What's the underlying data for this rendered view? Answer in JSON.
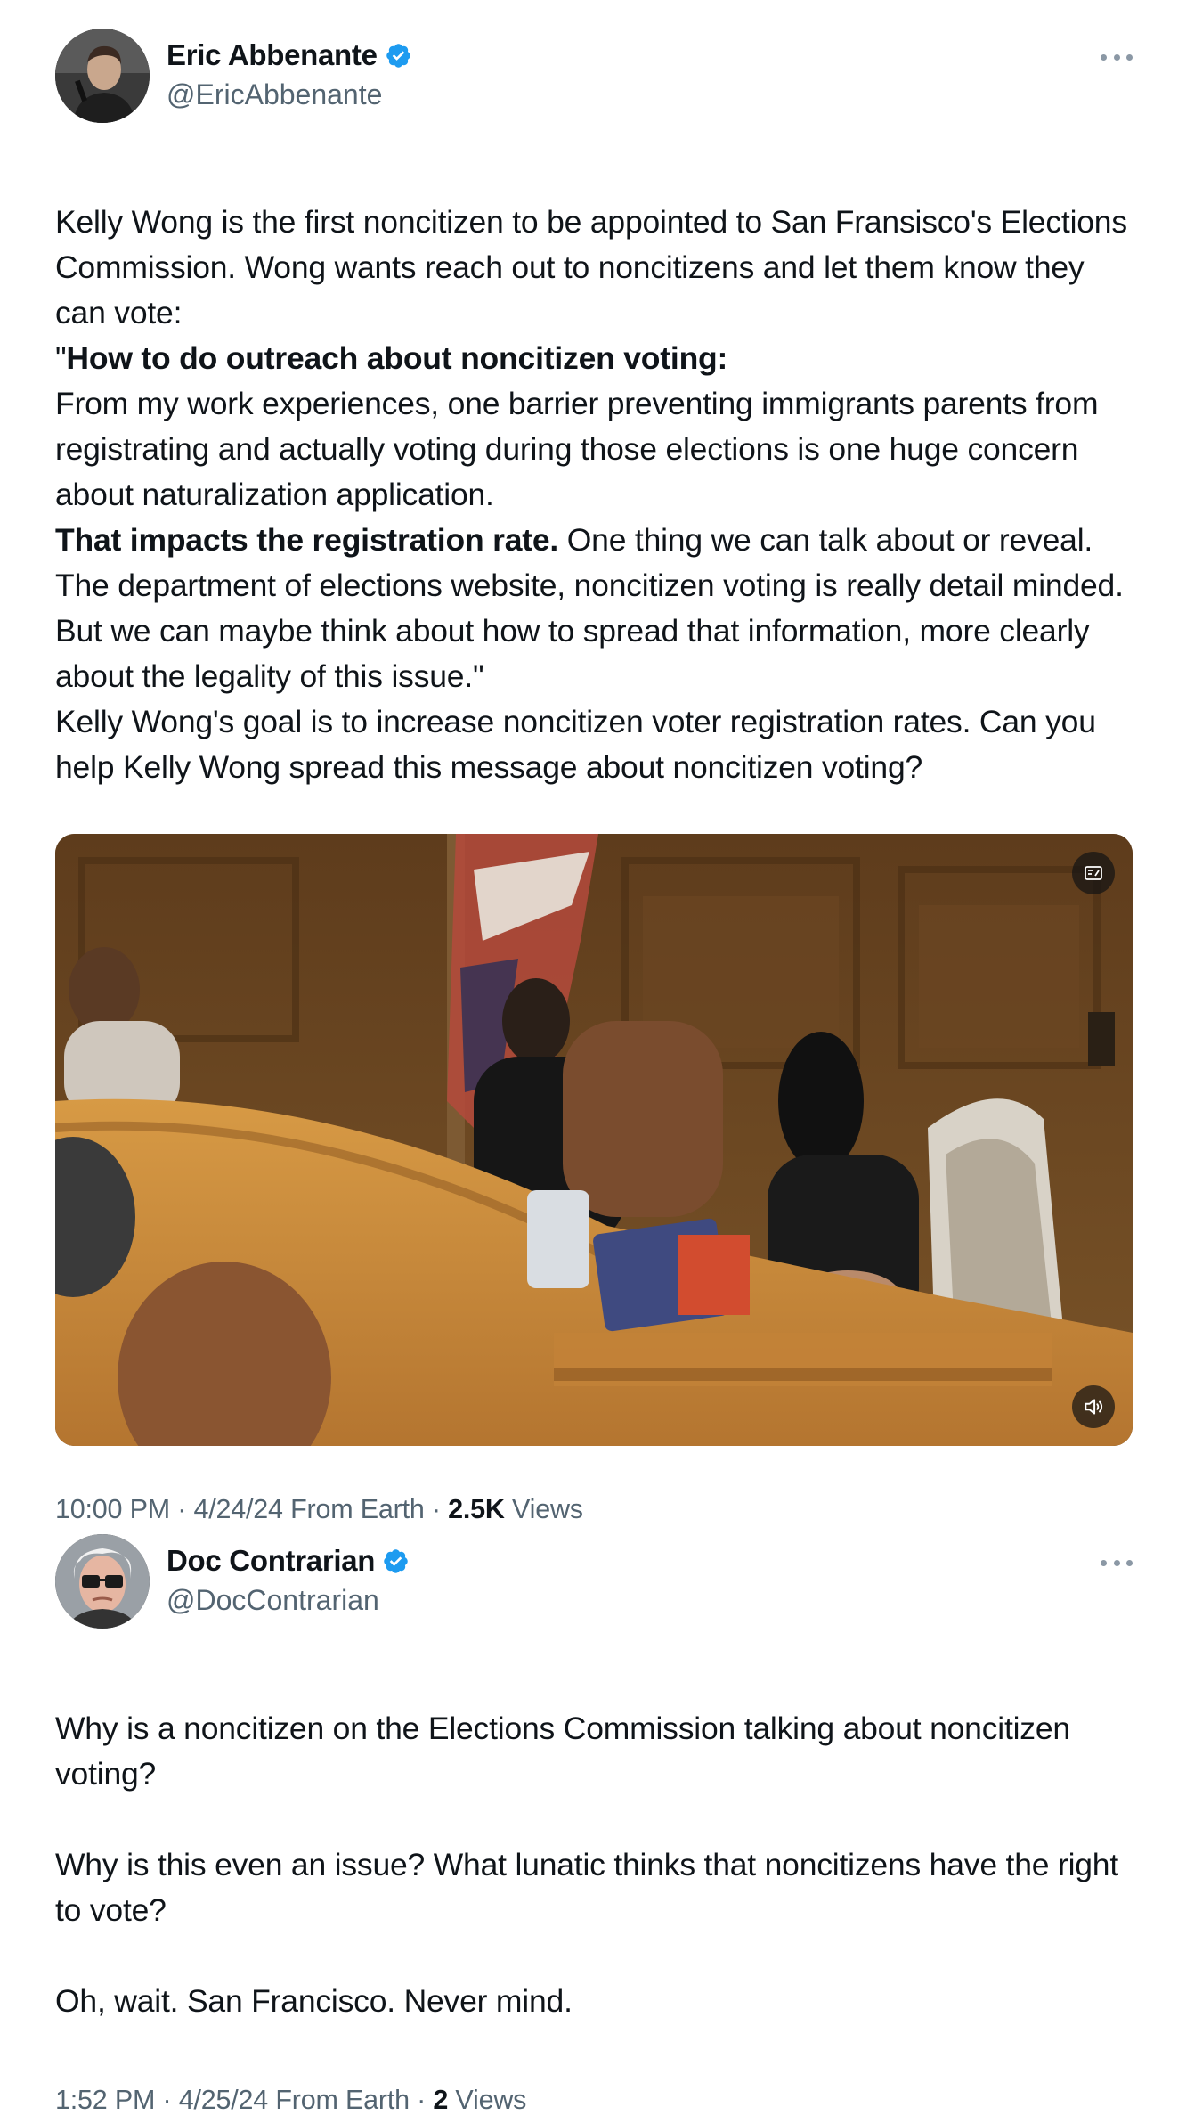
{
  "tweets": [
    {
      "author": {
        "name": "Eric Abbenante",
        "handle": "@EricAbbenante",
        "verified": true
      },
      "paragraphs": [
        "Kelly Wong is the first noncitizen to be appointed to San Fransisco's Elections Commission. Wong wants reach out to noncitizens and let them know they can vote:",
        {
          "prefix": "\"",
          "bold": "How to do outreach about noncitizen voting:",
          "rest": ""
        },
        "From my work experiences, one barrier preventing immigrants parents from registrating and actually voting during those elections is one huge concern about naturalization application.",
        {
          "prefix": "",
          "bold": "That impacts the registration rate.",
          "rest": " One thing we can talk about or reveal. The department of elections website, noncitizen voting is really detail minded. But we can maybe think about how to spread that information, more clearly about the legality of this issue.\""
        },
        "Kelly Wong's goal is to increase noncitizen voter registration rates. Can you help Kelly Wong spread this message about noncitizen voting?"
      ],
      "media": {
        "type": "video",
        "gif_icon": "gif-icon",
        "mute_icon": "speaker-icon"
      },
      "timestamp": "10:00 PM · 4/24/24 From Earth · ",
      "views_count": "2.5K",
      "views_label": " Views"
    },
    {
      "author": {
        "name": "Doc Contrarian",
        "handle": "@DocContrarian",
        "verified": true
      },
      "paragraphs": [
        "Why is a noncitizen on the Elections Commission talking about noncitizen voting?",
        "Why is this even an issue? What lunatic thinks that noncitizens have the right to vote?",
        "Oh, wait. San Francisco. Never mind."
      ],
      "timestamp": "1:52 PM · 4/25/24 From Earth · ",
      "views_count": "2",
      "views_label": " Views"
    }
  ],
  "colors": {
    "verified": "#1d9bf0",
    "secondary_text": "#536471",
    "primary_text": "#0f1419"
  }
}
